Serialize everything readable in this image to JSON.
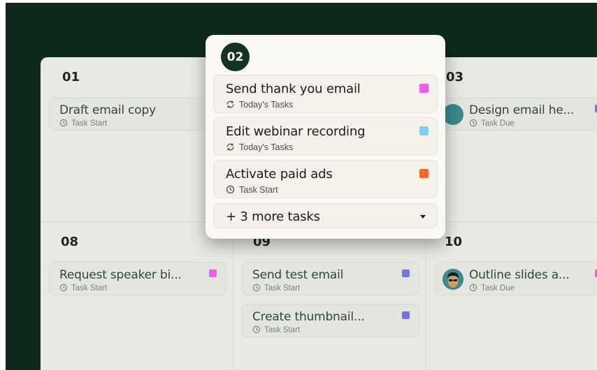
{
  "colors": {
    "background_frame": "#0f2a1d",
    "magenta": "#ee5ee3",
    "blue": "#6a78e0",
    "sky": "#7fd0ef",
    "orange": "#ef6a2a"
  },
  "calendar": {
    "cells": [
      {
        "day": "01",
        "cards": [
          {
            "title": "Draft email copy",
            "subtitle": "Task Start",
            "icon": "clock-start-icon",
            "color": "magenta"
          }
        ]
      },
      {
        "day": "03",
        "cards": [
          {
            "title": "Design email he...",
            "subtitle": "Task Due",
            "icon": "clock-due-icon",
            "color": "blue",
            "avatar": true
          }
        ]
      },
      {
        "day": "08",
        "cards": [
          {
            "title": "Request speaker bi...",
            "subtitle": "Task Start",
            "icon": "clock-start-icon",
            "color": "magenta"
          }
        ]
      },
      {
        "day": "09",
        "cards": [
          {
            "title": "Send test email",
            "subtitle": "Task Start",
            "icon": "clock-start-icon",
            "color": "blue"
          },
          {
            "title": "Create thumbnail...",
            "subtitle": "Task Start",
            "icon": "clock-start-icon",
            "color": "blue"
          }
        ]
      },
      {
        "day": "10",
        "cards": [
          {
            "title": "Outline slides a...",
            "subtitle": "Task Due",
            "icon": "clock-due-icon",
            "color": "magenta",
            "avatar": true
          }
        ]
      }
    ]
  },
  "popup": {
    "day": "02",
    "tasks": [
      {
        "title": "Send thank you email",
        "subtitle": "Today's Tasks",
        "icon": "recurring-icon",
        "color": "magenta"
      },
      {
        "title": "Edit webinar recording",
        "subtitle": "Today's Tasks",
        "icon": "recurring-icon",
        "color": "sky"
      },
      {
        "title": "Activate paid ads",
        "subtitle": "Task Start",
        "icon": "clock-start-icon",
        "color": "orange"
      }
    ],
    "more_label": "+ 3 more tasks"
  }
}
